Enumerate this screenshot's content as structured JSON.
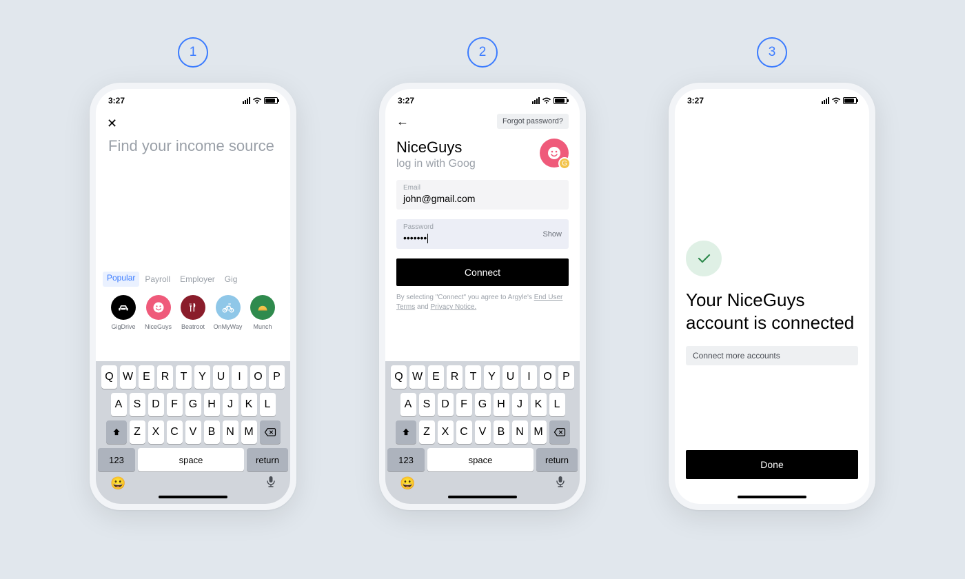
{
  "status": {
    "time": "3:27"
  },
  "steps": [
    "1",
    "2",
    "3"
  ],
  "s1": {
    "search_placeholder": "Find your income source",
    "tabs": [
      "Popular",
      "Payroll",
      "Employer",
      "Gig"
    ],
    "providers": [
      {
        "label": "GigDrive",
        "icon": "car",
        "bg": "#000000"
      },
      {
        "label": "NiceGuys",
        "icon": "smile",
        "bg": "#ef5a7a"
      },
      {
        "label": "Beatroot",
        "icon": "fork",
        "bg": "#8a1d2b"
      },
      {
        "label": "OnMyWay",
        "icon": "bike",
        "bg": "#8fc7e8"
      },
      {
        "label": "Munch",
        "icon": "munch",
        "bg": "#2f8a4d"
      }
    ]
  },
  "s2": {
    "forgot": "Forgot password?",
    "brand": "NiceGuys",
    "sub": "log in with Goog",
    "email_label": "Email",
    "email_value": "john@gmail.com",
    "password_label": "Password",
    "password_value": "•••••••",
    "show": "Show",
    "connect": "Connect",
    "legal_pre": "By selecting \"Connect\" you agree to Argyle's ",
    "legal_link1": "End User Terms",
    "legal_mid": " and ",
    "legal_link2": "Privacy Notice."
  },
  "s3": {
    "headline": "Your NiceGuys account is connected",
    "more": "Connect more accounts",
    "done": "Done"
  },
  "kb": {
    "rows": [
      [
        "Q",
        "W",
        "E",
        "R",
        "T",
        "Y",
        "U",
        "I",
        "O",
        "P"
      ],
      [
        "A",
        "S",
        "D",
        "F",
        "G",
        "H",
        "J",
        "K",
        "L"
      ],
      [
        "Z",
        "X",
        "C",
        "V",
        "B",
        "N",
        "M"
      ]
    ],
    "num": "123",
    "space": "space",
    "ret": "return"
  }
}
